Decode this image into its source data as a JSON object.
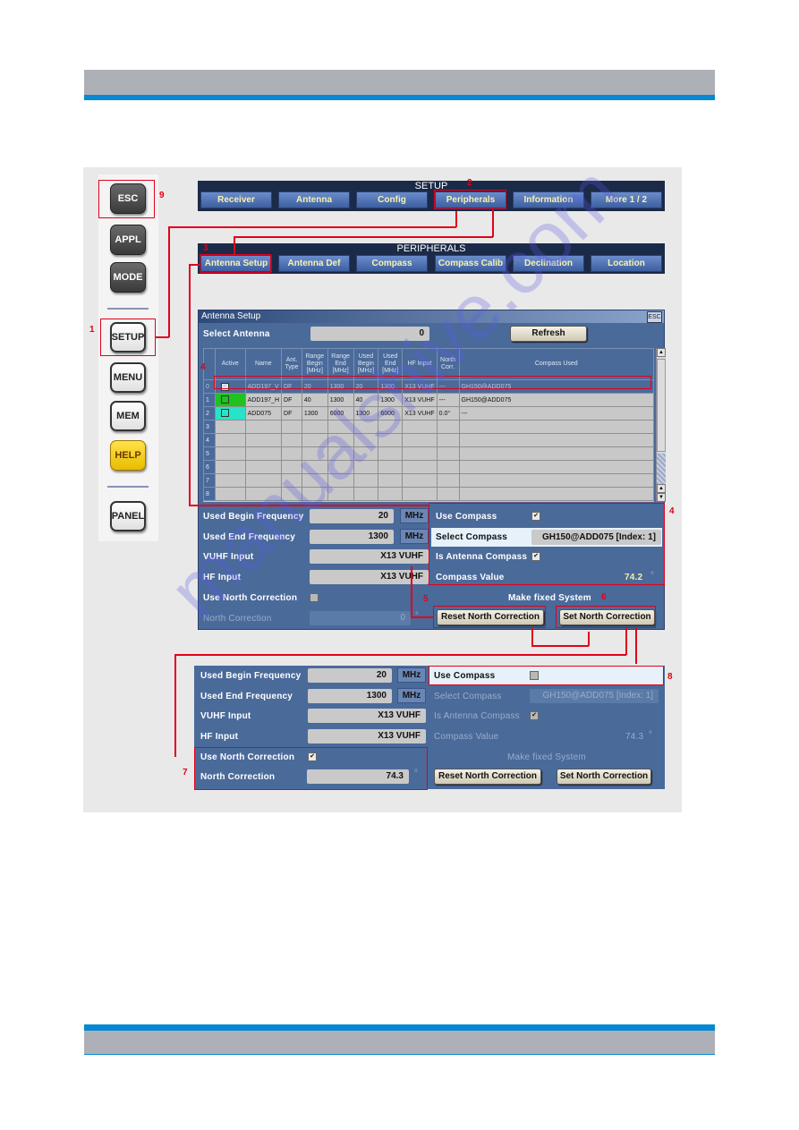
{
  "page": {
    "header_band_color": "#adb1b7",
    "accent_color": "#0788d2",
    "annotation_color": "#e2001a"
  },
  "hardware_keys": [
    {
      "label": "ESC",
      "style": "dark"
    },
    {
      "label": "APPL",
      "style": "dark"
    },
    {
      "label": "MODE",
      "style": "dark"
    },
    {
      "label": "SETUP",
      "style": "light"
    },
    {
      "label": "MENU",
      "style": "light"
    },
    {
      "label": "MEM",
      "style": "light"
    },
    {
      "label": "HELP",
      "style": "yellow"
    },
    {
      "label": "PANEL",
      "style": "light"
    }
  ],
  "setup_menu": {
    "title": "SETUP",
    "softkeys": [
      "Receiver",
      "Antenna",
      "Config",
      "Peripherals",
      "Information",
      "More 1 / 2"
    ]
  },
  "peripherals_menu": {
    "title": "PERIPHERALS",
    "softkeys": [
      "Antenna Setup",
      "Antenna Def",
      "Compass",
      "Compass Calib",
      "Declination",
      "Location"
    ]
  },
  "dialog": {
    "title": "Antenna Setup",
    "esc_label": "ESC",
    "select_antenna_label": "Select Antenna",
    "select_antenna_value": "0",
    "refresh_label": "Refresh",
    "table": {
      "headers": [
        "",
        "Active",
        "Name",
        "Ant. Type",
        "Range Begin [MHz]",
        "Range End [MHz]",
        "Used Begin [MHz]",
        "Used End [MHz]",
        "HF Input",
        "North Corr.",
        "Compass Used"
      ],
      "rows": [
        {
          "index": "0",
          "active": true,
          "active_color": "",
          "name": "ADD197_V",
          "type": "DF",
          "range_begin": "20",
          "range_end": "1300",
          "used_begin": "20",
          "used_end": "1300",
          "hf_input": "X13 VUHF",
          "north_corr": "---",
          "compass": "GH150@ADD075",
          "selected": true
        },
        {
          "index": "1",
          "active": false,
          "active_color": "#1fc21f",
          "name": "ADD197_H",
          "type": "DF",
          "range_begin": "40",
          "range_end": "1300",
          "used_begin": "40",
          "used_end": "1300",
          "hf_input": "X13 VUHF",
          "north_corr": "---",
          "compass": "GH150@ADD075",
          "selected": false
        },
        {
          "index": "2",
          "active": false,
          "active_color": "#27e3c8",
          "name": "ADD075",
          "type": "DF",
          "range_begin": "1300",
          "range_end": "6000",
          "used_begin": "1300",
          "used_end": "6000",
          "hf_input": "X13 VUHF",
          "north_corr": "0.0°",
          "compass": "---",
          "selected": false
        },
        {
          "index": "3"
        },
        {
          "index": "4"
        },
        {
          "index": "5"
        },
        {
          "index": "6"
        },
        {
          "index": "7"
        },
        {
          "index": "8"
        }
      ]
    },
    "fields": {
      "used_begin_label": "Used Begin Frequency",
      "used_begin_value": "20",
      "used_begin_unit": "MHz",
      "used_end_label": "Used End Frequency",
      "used_end_value": "1300",
      "used_end_unit": "MHz",
      "vuhf_label": "VUHF Input",
      "vuhf_value": "X13 VUHF",
      "hf_label": "HF Input",
      "hf_value": "X13 VUHF",
      "use_north_label": "Use North Correction",
      "use_north_checked": false,
      "north_label": "North Correction",
      "north_value": "0",
      "north_unit": "°",
      "use_compass_label": "Use Compass",
      "use_compass_checked": true,
      "select_compass_label": "Select Compass",
      "select_compass_value": "GH150@ADD075 [Index: 1]",
      "is_antenna_compass_label": "Is Antenna Compass",
      "is_antenna_compass_checked": true,
      "compass_value_label": "Compass Value",
      "compass_value": "74.2",
      "compass_unit": "°",
      "make_fixed_label": "Make fixed System",
      "reset_north_label": "Reset North Correction",
      "set_north_label": "Set North Correction"
    }
  },
  "panel2": {
    "used_begin_label": "Used Begin Frequency",
    "used_begin_value": "20",
    "used_begin_unit": "MHz",
    "used_end_label": "Used End Frequency",
    "used_end_value": "1300",
    "used_end_unit": "MHz",
    "vuhf_label": "VUHF Input",
    "vuhf_value": "X13 VUHF",
    "hf_label": "HF Input",
    "hf_value": "X13 VUHF",
    "use_north_label": "Use North Correction",
    "use_north_checked": true,
    "north_label": "North Correction",
    "north_value": "74.3",
    "north_unit": "°",
    "use_compass_label": "Use Compass",
    "use_compass_checked": false,
    "select_compass_label": "Select Compass",
    "select_compass_value": "GH150@ADD075 [Index: 1]",
    "is_antenna_compass_label": "Is Antenna Compass",
    "is_antenna_compass_checked": true,
    "compass_value_label": "Compass Value",
    "compass_value": "74.3",
    "compass_unit": "°",
    "make_fixed_label": "Make fixed System",
    "reset_north_label": "Reset North Correction",
    "set_north_label": "Set North Correction"
  },
  "annotations": [
    "1",
    "2",
    "3",
    "4",
    "4",
    "5",
    "6",
    "7",
    "8",
    "9"
  ],
  "watermark": "manualshive.com"
}
